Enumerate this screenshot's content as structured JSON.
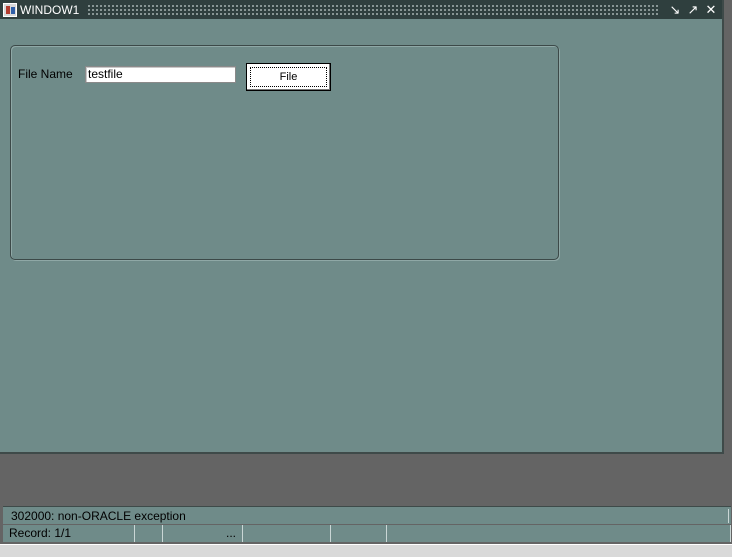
{
  "window": {
    "title": "WINDOW1",
    "buttons": [
      "minimize",
      "restore",
      "close"
    ]
  },
  "form": {
    "file_name_label": "File Name",
    "file_name_value": "testfile",
    "file_button_label": "File"
  },
  "status": {
    "message": "302000: non-ORACLE exception",
    "record": "Record: 1/1",
    "segment_3": "..."
  },
  "colors": {
    "window_bg": "#6f8b89",
    "titlebar_bg": "#2f3f3e",
    "desktop_bg": "#646464"
  }
}
